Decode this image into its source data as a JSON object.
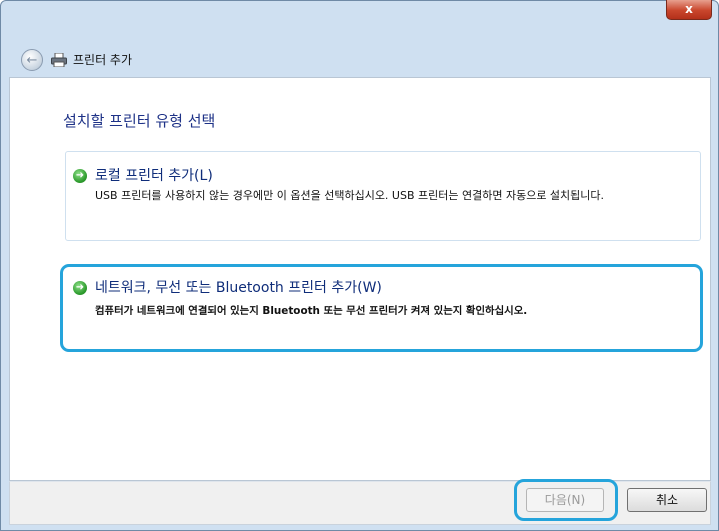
{
  "window": {
    "close_label": "x"
  },
  "nav": {
    "back_glyph": "←",
    "title": "프린터 추가"
  },
  "main": {
    "heading": "설치할 프린터 유형 선택",
    "options": [
      {
        "title": "로컬 프린터 추가(L)",
        "description": "USB 프린터를 사용하지 않는 경우에만 이 옵션을 선택하십시오. USB 프린터는 연결하면 자동으로 설치됩니다.",
        "icon": "green-arrow-icon"
      },
      {
        "title": "네트워크, 무선 또는 Bluetooth 프린터 추가(W)",
        "description": "컴퓨터가 네트워크에 연결되어 있는지 Bluetooth 또는 무선 프린터가 켜져 있는지 확인하십시오.",
        "icon": "green-arrow-icon"
      }
    ]
  },
  "footer": {
    "next_label": "다음(N)",
    "cancel_label": "취소"
  },
  "colors": {
    "highlight": "#25a4db",
    "heading": "#1e3287",
    "option_title": "#0f2d7a"
  }
}
